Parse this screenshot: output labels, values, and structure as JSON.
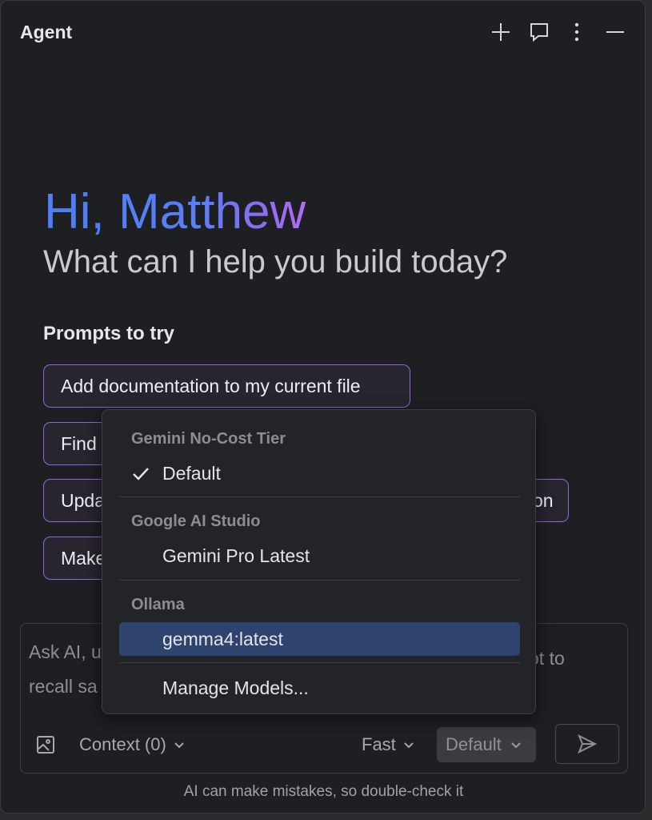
{
  "header": {
    "title": "Agent",
    "icons": [
      "plus-icon",
      "chat-icon",
      "more-vertical-icon",
      "minimize-icon"
    ]
  },
  "welcome": {
    "greeting": "Hi, Matthew",
    "subtitle": "What can I help you build today?"
  },
  "prompts": {
    "title": "Prompts to try",
    "items": [
      "Add documentation to my current file",
      "Find",
      "Upda",
      "Make"
    ],
    "partial_suffix": "on"
  },
  "model_menu": {
    "groups": [
      {
        "label": "Gemini No-Cost Tier",
        "items": [
          {
            "label": "Default",
            "checked": true
          }
        ]
      },
      {
        "label": "Google AI Studio",
        "items": [
          {
            "label": "Gemini Pro Latest"
          }
        ]
      },
      {
        "label": "Ollama",
        "items": [
          {
            "label": "gemma4:latest",
            "highlighted": true
          }
        ]
      }
    ],
    "manage_label": "Manage Models..."
  },
  "input": {
    "placeholder_line1": "Ask AI, u",
    "placeholder_line2": "recall sa",
    "placeholder_right": "ot to",
    "context_label": "Context (0)",
    "speed_label": "Fast",
    "model_label": "Default"
  },
  "footer": {
    "disclaimer": "AI can make mistakes, so double-check it"
  },
  "colors": {
    "background": "#1e1f22",
    "chip_border": "#8c6ad6",
    "highlight": "#2e436d",
    "greeting_gradient_start": "#4f7ef7",
    "greeting_gradient_end": "#b06cf2"
  }
}
